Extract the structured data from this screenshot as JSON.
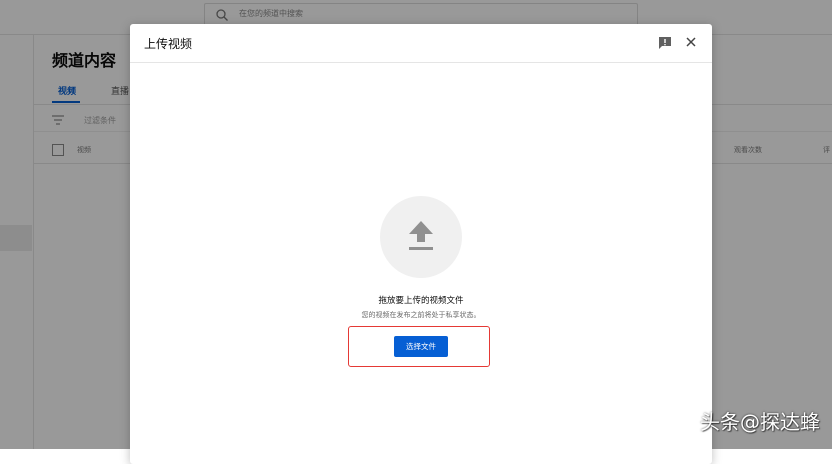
{
  "search": {
    "placeholder": "在您的频道中搜索"
  },
  "page": {
    "title": "频道内容",
    "tabs": [
      {
        "label": "视频",
        "active": true
      },
      {
        "label": "直播",
        "active": false
      }
    ],
    "filter_label": "过滤条件",
    "columns": {
      "video": "视频",
      "views": "观看次数",
      "comments": "评"
    }
  },
  "dialog": {
    "title": "上传视频",
    "icons": {
      "feedback": "feedback-icon",
      "close": "close-icon",
      "upload": "upload-arrow-icon"
    },
    "drop_title": "拖放要上传的视频文件",
    "drop_subtitle": "您的视频在发布之前将处于私享状态。",
    "select_button": "选择文件"
  },
  "watermark": "头条@探达蜂",
  "colors": {
    "accent": "#065fd4",
    "highlight": "#e53935",
    "overlay": "rgba(0,0,0,0.4)"
  }
}
